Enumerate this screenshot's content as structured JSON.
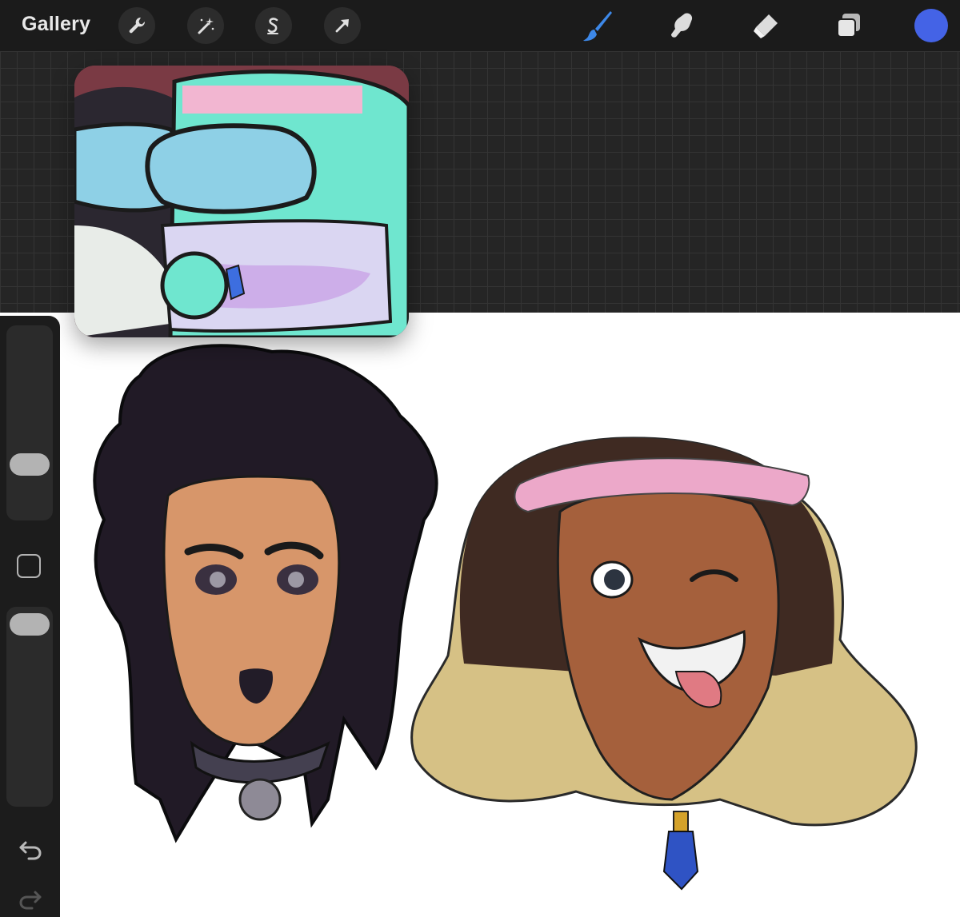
{
  "app": {
    "gallery_label": "Gallery"
  },
  "toolbar": {
    "left_tools": [
      "wrench-icon",
      "magic-wand-icon",
      "selection-icon",
      "transform-arrow-icon"
    ],
    "right_tools": [
      "brush-icon",
      "smudge-icon",
      "eraser-icon",
      "layers-icon"
    ],
    "active_tool": "brush",
    "active_tool_color": "#3d88e8",
    "current_color": "#4463e6"
  },
  "sidebar": {
    "brush_size_level": 0.8,
    "opacity_level": 0.15,
    "icons": [
      "modify-square-icon",
      "undo-icon",
      "redo-icon"
    ]
  },
  "canvas": {
    "grid_color": "#343434",
    "dark_bg": "#252525",
    "paper_color": "#ffffff"
  },
  "reference": {
    "description_icon": "reference-image"
  }
}
